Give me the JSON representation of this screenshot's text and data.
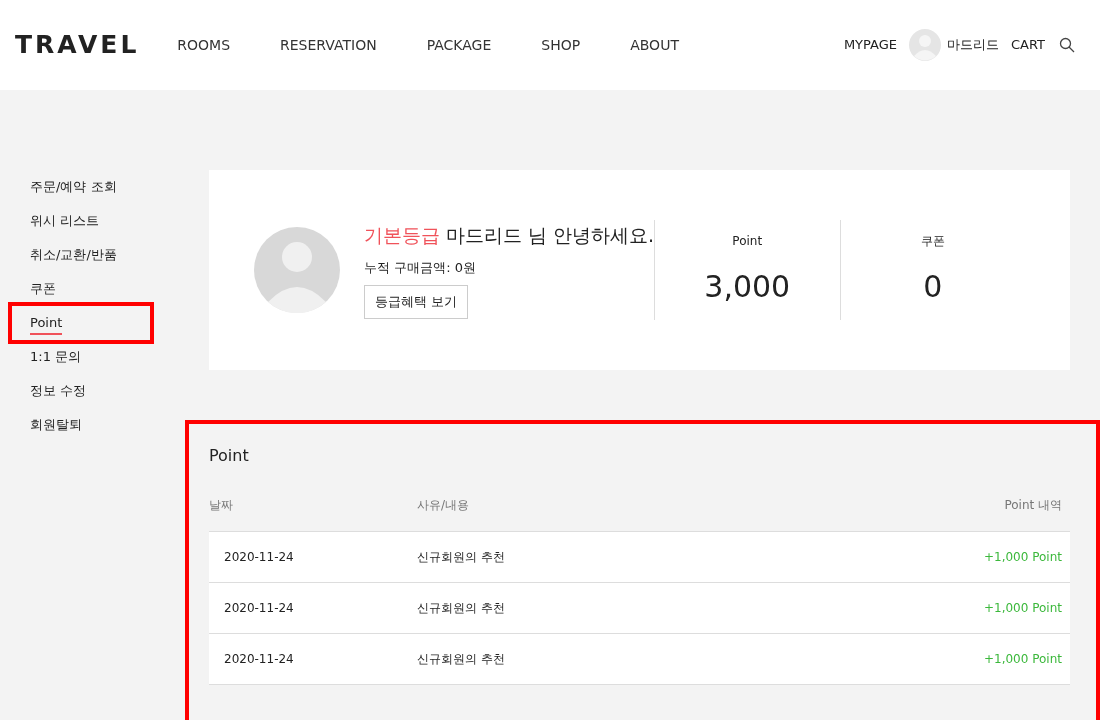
{
  "header": {
    "logo": "TRAVEL",
    "nav": [
      "ROOMS",
      "RESERVATION",
      "PACKAGE",
      "SHOP",
      "ABOUT"
    ],
    "mypage": "MYPAGE",
    "username": "마드리드",
    "cart": "CART"
  },
  "sidebar": {
    "items": [
      {
        "label": "주문/예약 조회",
        "selected": false
      },
      {
        "label": "위시 리스트",
        "selected": false
      },
      {
        "label": "취소/교환/반품",
        "selected": false
      },
      {
        "label": "쿠폰",
        "selected": false
      },
      {
        "label": "Point",
        "selected": true
      },
      {
        "label": "1:1 문의",
        "selected": false
      },
      {
        "label": "정보 수정",
        "selected": false
      },
      {
        "label": "회원탈퇴",
        "selected": false
      }
    ]
  },
  "profile": {
    "grade": "기본등급",
    "greeting": "마드리드 님 안녕하세요.",
    "total_purchase": "누적 구매금액: 0원",
    "benefits_button": "등급혜택 보기",
    "stats": [
      {
        "label": "Point",
        "value": "3,000"
      },
      {
        "label": "쿠폰",
        "value": "0"
      }
    ]
  },
  "point_history": {
    "title": "Point",
    "columns": [
      "날짜",
      "사유/내용",
      "Point 내역"
    ],
    "rows": [
      [
        "2020-11-24",
        "신규회원의 추천",
        "+1,000 Point"
      ],
      [
        "2020-11-24",
        "신규회원의 추천",
        "+1,000 Point"
      ],
      [
        "2020-11-24",
        "신규회원의 추천",
        "+1,000 Point"
      ]
    ]
  }
}
